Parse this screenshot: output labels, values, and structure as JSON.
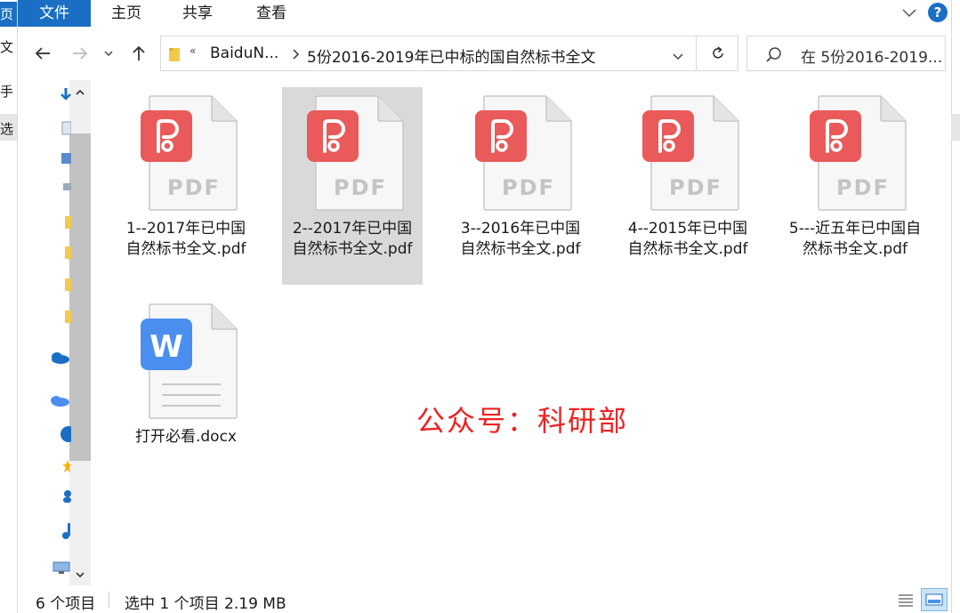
{
  "background_window": {
    "tab_fragment": "页",
    "lines": [
      "文",
      "手",
      "选"
    ]
  },
  "ribbon": {
    "tabs": [
      "文件",
      "主页",
      "共享",
      "查看"
    ],
    "help_label": "?"
  },
  "address_bar": {
    "overflow": "«",
    "crumbs": [
      "BaiduN...",
      "5份2016-2019年已中标的国自然标书全文"
    ]
  },
  "search": {
    "placeholder": "在 5份2016-2019..."
  },
  "files": [
    {
      "name": "1--2017年已中国自然标书全文.pdf",
      "type": "pdf",
      "selected": false
    },
    {
      "name": "2--2017年已中国自然标书全文.pdf",
      "type": "pdf",
      "selected": true
    },
    {
      "name": "3--2016年已中国自然标书全文.pdf",
      "type": "pdf",
      "selected": false
    },
    {
      "name": "4--2015年已中国自然标书全文.pdf",
      "type": "pdf",
      "selected": false
    },
    {
      "name": "5---近五年已中国自然标书全文.pdf",
      "type": "pdf",
      "selected": false
    },
    {
      "name": "打开必看.docx",
      "type": "docx",
      "selected": false
    }
  ],
  "icon_labels": {
    "pdf": "PDF",
    "word": "W"
  },
  "watermark": "公众号：科研部",
  "status": {
    "item_count": "6 个项目",
    "selection": "选中 1 个项目  2.19 MB"
  },
  "colors": {
    "accent": "#1a6fc4",
    "pdf_red": "#ea5a5a",
    "word_blue": "#4a8ff0",
    "selection": "#d9d9d9",
    "watermark": "#ee2222"
  }
}
